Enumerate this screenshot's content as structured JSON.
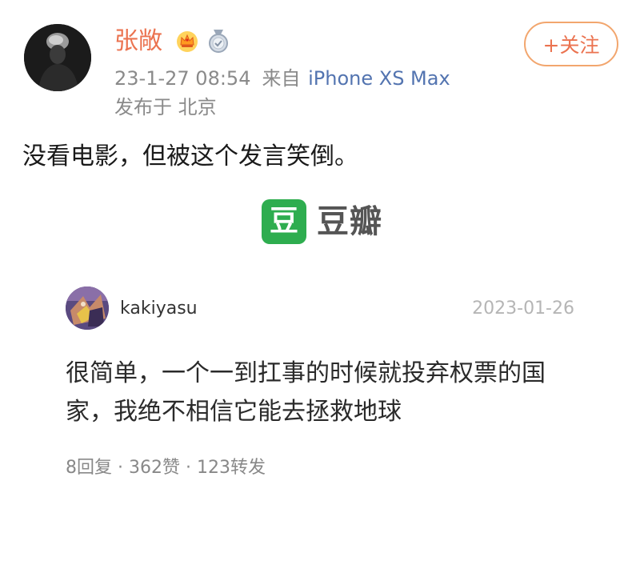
{
  "post": {
    "author": {
      "name": "张敞",
      "avatar_icon": "user-avatar-portrait",
      "badges": [
        "crown-badge-icon",
        "medal-badge-icon"
      ]
    },
    "timestamp": "23-1-27 08:54",
    "source_prefix": "来自",
    "device": "iPhone XS Max",
    "location": "发布于 北京",
    "follow_label": "+关注",
    "text": "没看电影，但被这个发言笑倒。"
  },
  "embed": {
    "logo_glyph": "豆",
    "logo_text": "豆瓣",
    "brand_color": "#2ead4f"
  },
  "comment": {
    "user": "kakiyasu",
    "date": "2023-01-26",
    "text": "很简单，一个一到扛事的时候就投弃权票的国家，我绝不相信它能去拯救地球",
    "stats": "8回复 · 362赞 · 123转发"
  },
  "colors": {
    "accent": "#eb7350",
    "link": "#5374b0",
    "meta": "#8a8a8a"
  }
}
